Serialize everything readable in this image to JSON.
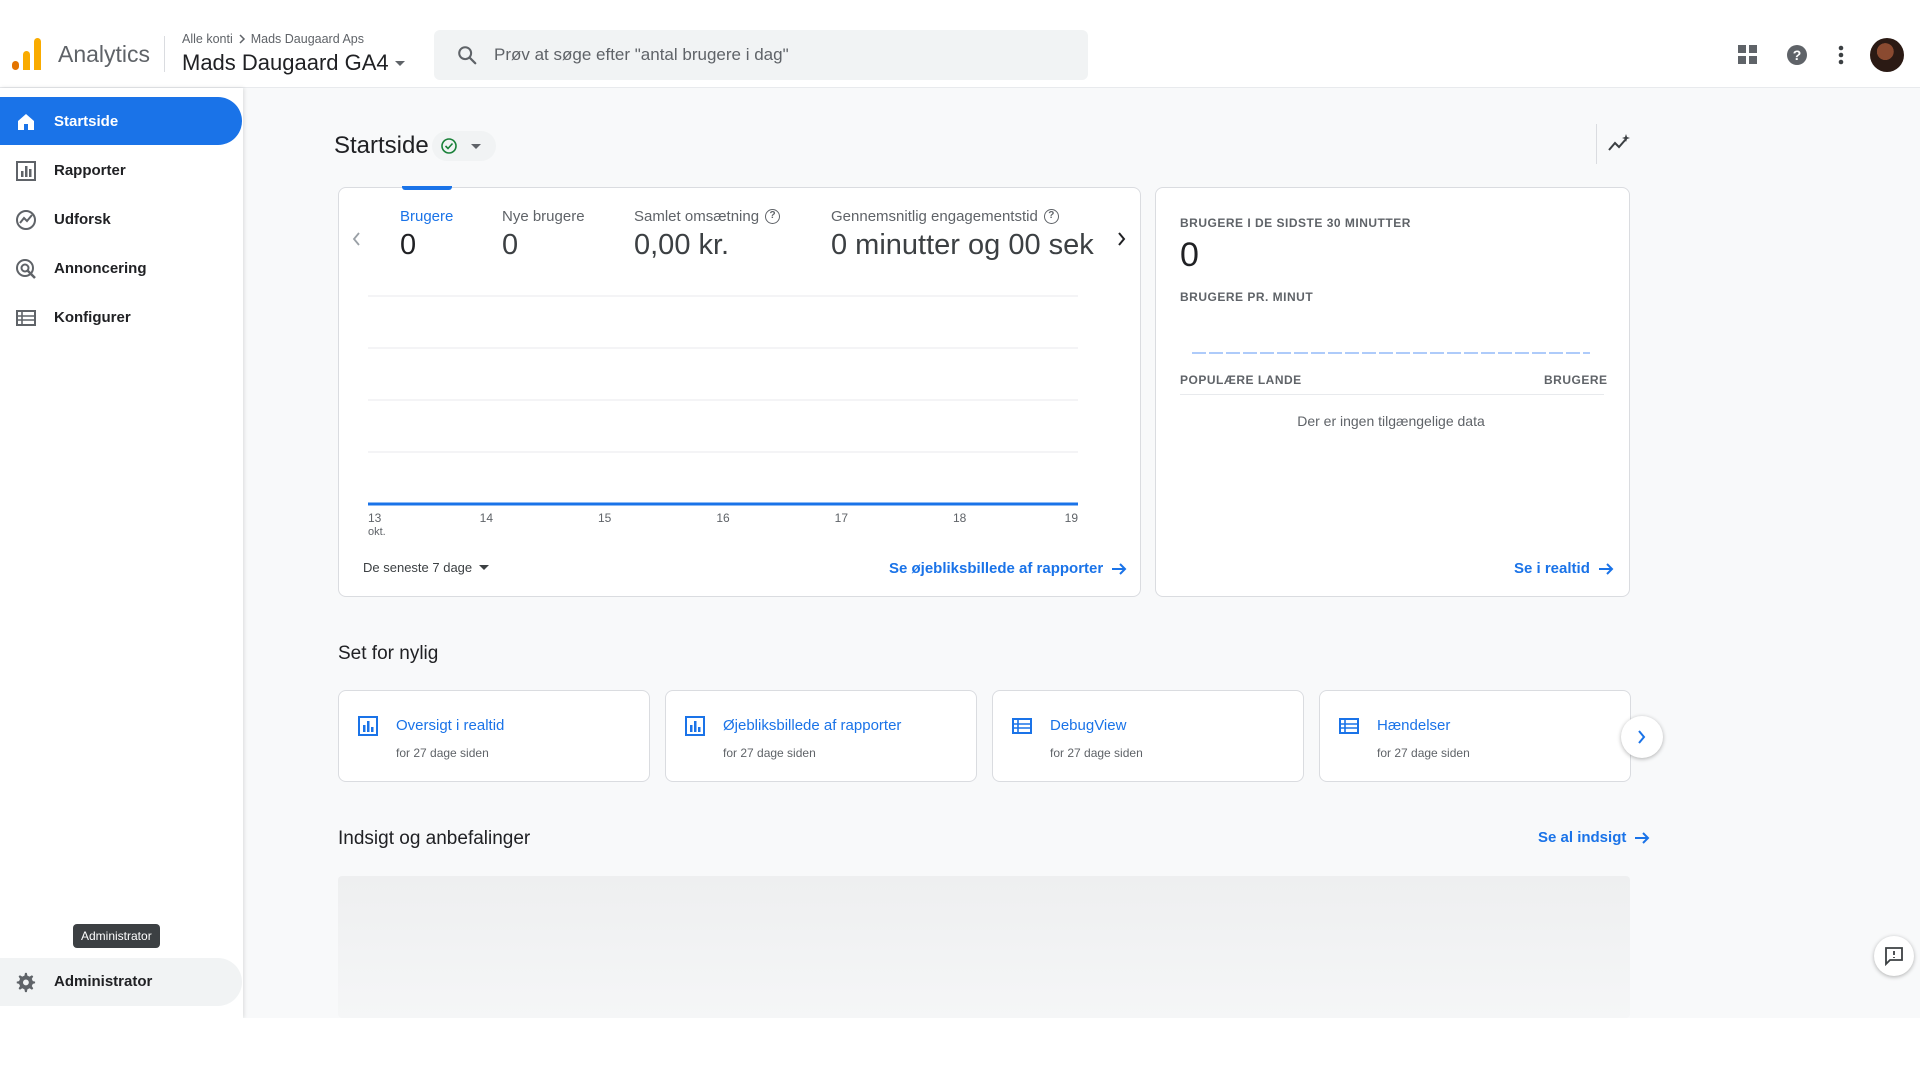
{
  "colors": {
    "accent": "#1a73e8",
    "logo_orange": "#f9ab00",
    "logo_dark_orange": "#e37400"
  },
  "header": {
    "app_name": "Analytics",
    "breadcrumb": {
      "account": "Alle konti",
      "property_group": "Mads Daugaard Aps"
    },
    "property_name": "Mads Daugaard GA4",
    "search_placeholder": "Prøv at søge efter \"antal brugere i dag\"",
    "icons": [
      "apps-grid-icon",
      "help-icon",
      "more-vert-icon",
      "avatar"
    ]
  },
  "sidebar": {
    "items": [
      {
        "label": "Startside",
        "icon": "home-icon",
        "active": true
      },
      {
        "label": "Rapporter",
        "icon": "bar-chart-icon",
        "active": false
      },
      {
        "label": "Udforsk",
        "icon": "explore-icon",
        "active": false
      },
      {
        "label": "Annoncering",
        "icon": "ads-icon",
        "active": false
      },
      {
        "label": "Konfigurer",
        "icon": "configure-icon",
        "active": false
      }
    ],
    "admin_tooltip": "Administrator",
    "admin_label": "Administrator"
  },
  "page": {
    "title": "Startside"
  },
  "overview": {
    "metrics": [
      {
        "label": "Brugere",
        "value": "0",
        "active": true
      },
      {
        "label": "Nye brugere",
        "value": "0",
        "active": false
      },
      {
        "label": "Samlet omsætning",
        "value": "0,00 kr.",
        "active": false,
        "help": true
      },
      {
        "label": "Gennemsnitlig engagementstid",
        "value": "0 minutter og 00 sek",
        "active": false,
        "help": true
      }
    ],
    "date_range": "De seneste 7 dage",
    "link": "Se øjebliksbillede af rapporter"
  },
  "chart_data": {
    "type": "line",
    "x": [
      "13",
      "14",
      "15",
      "16",
      "17",
      "18",
      "19"
    ],
    "x_sublabel": "okt.",
    "series": [
      {
        "values": [
          0,
          0,
          0,
          0,
          0,
          0,
          0
        ]
      }
    ],
    "grid": true
  },
  "realtime": {
    "title": "BRUGERE I DE SIDSTE 30 MINUTTER",
    "value": "0",
    "per_minute_label": "BRUGERE PR. MINUT",
    "col_country": "POPULÆRE LANDE",
    "col_users": "BRUGERE",
    "empty": "Der er ingen tilgængelige data",
    "link": "Se i realtid"
  },
  "recent": {
    "title": "Set for nylig",
    "items": [
      {
        "title": "Oversigt i realtid",
        "sub": "for 27 dage siden",
        "icon": "report-icon"
      },
      {
        "title": "Øjebliksbillede af rapporter",
        "sub": "for 27 dage siden",
        "icon": "report-icon"
      },
      {
        "title": "DebugView",
        "sub": "for 27 dage siden",
        "icon": "list-icon"
      },
      {
        "title": "Hændelser",
        "sub": "for 27 dage siden",
        "icon": "list-icon"
      }
    ]
  },
  "insights": {
    "title": "Indsigt og anbefalinger",
    "link": "Se al indsigt"
  }
}
